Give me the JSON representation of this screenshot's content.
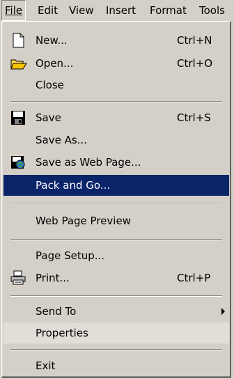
{
  "menubar": {
    "items": [
      {
        "label": "File"
      },
      {
        "label": "Edit"
      },
      {
        "label": "View"
      },
      {
        "label": "Insert"
      },
      {
        "label": "Format"
      },
      {
        "label": "Tools"
      }
    ]
  },
  "file_menu": {
    "items": [
      {
        "label": "New...",
        "accelerator": "Ctrl+N",
        "icon": "new-document-icon"
      },
      {
        "label": "Open...",
        "accelerator": "Ctrl+O",
        "icon": "open-folder-icon"
      },
      {
        "label": "Close"
      },
      {
        "label": "Save",
        "accelerator": "Ctrl+S",
        "icon": "save-disk-icon"
      },
      {
        "label": "Save As..."
      },
      {
        "label": "Save as Web Page...",
        "icon": "web-page-icon"
      },
      {
        "label": "Pack and Go...",
        "state": "highlighted"
      },
      {
        "label": "Web Page Preview"
      },
      {
        "label": "Page Setup..."
      },
      {
        "label": "Print...",
        "accelerator": "Ctrl+P",
        "icon": "printer-icon"
      },
      {
        "label": "Send To",
        "submenu": true
      },
      {
        "label": "Properties"
      },
      {
        "label": "Exit"
      }
    ]
  },
  "colors": {
    "menu_background": "#d4d0c8",
    "highlight": "#0a246a",
    "highlight_text": "#ffffff"
  }
}
